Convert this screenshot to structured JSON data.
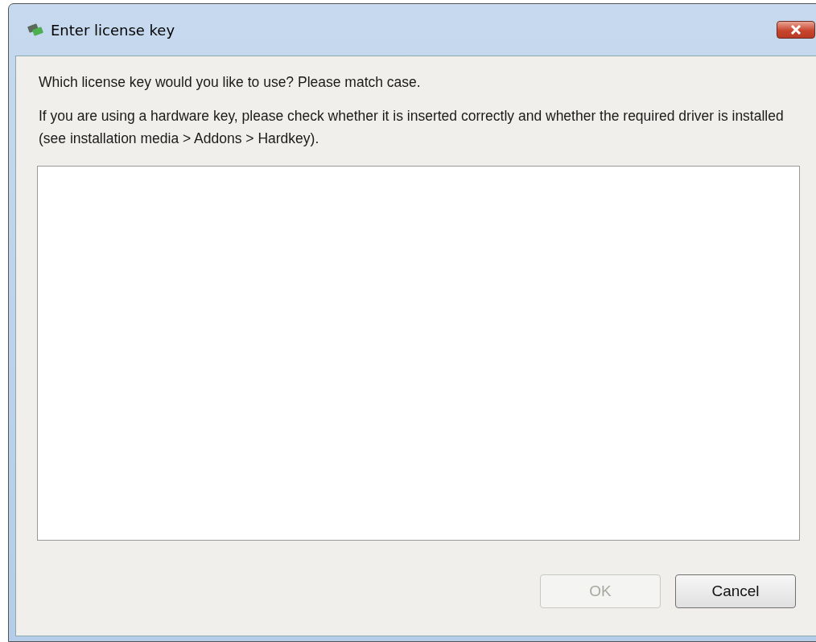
{
  "window": {
    "title": "Enter license key"
  },
  "prompt": "Which license key would you like to use? Please match case.",
  "hint": "If you are using a hardware key, please check whether it is inserted correctly and whether the required driver is installed (see installation media > Addons > Hardkey).",
  "buttons": [
    {
      "label": "OK",
      "disabled": true
    },
    {
      "label": "Cancel",
      "disabled": false
    }
  ]
}
